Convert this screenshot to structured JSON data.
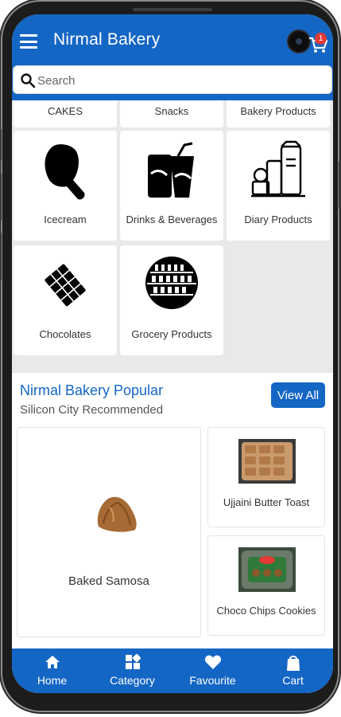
{
  "header": {
    "title": "Nirmal Bakery",
    "cart_count": "1"
  },
  "search": {
    "placeholder": "Search"
  },
  "categories": [
    {
      "label": "CAKES",
      "icon": "cake-icon"
    },
    {
      "label": "Snacks",
      "icon": "snacks-icon"
    },
    {
      "label": "Bakery Products",
      "icon": "bakery-icon"
    },
    {
      "label": "Icecream",
      "icon": "icecream-icon"
    },
    {
      "label": "Drinks & Beverages",
      "icon": "drinks-icon"
    },
    {
      "label": "Diary Products",
      "icon": "dairy-icon"
    },
    {
      "label": "Chocolates",
      "icon": "chocolate-icon"
    },
    {
      "label": "Grocery Products",
      "icon": "grocery-icon"
    }
  ],
  "popular": {
    "title": "Nirmal Bakery Popular",
    "subtitle": "Silicon City Recommended",
    "view_all_label": "View All",
    "products": [
      {
        "name": "Baked Samosa",
        "icon": "samosa-image"
      },
      {
        "name": "Ujjaini Butter Toast",
        "icon": "butter-toast-image"
      },
      {
        "name": "Choco Chips Cookies",
        "icon": "cookies-image"
      }
    ]
  },
  "bottom_nav": [
    {
      "label": "Home",
      "icon": "home-icon"
    },
    {
      "label": "Category",
      "icon": "category-icon"
    },
    {
      "label": "Favourite",
      "icon": "heart-icon"
    },
    {
      "label": "Cart",
      "icon": "cart-icon"
    }
  ],
  "colors": {
    "primary": "#1466c4",
    "badge": "#e53935",
    "background": "#e9e9eb"
  }
}
